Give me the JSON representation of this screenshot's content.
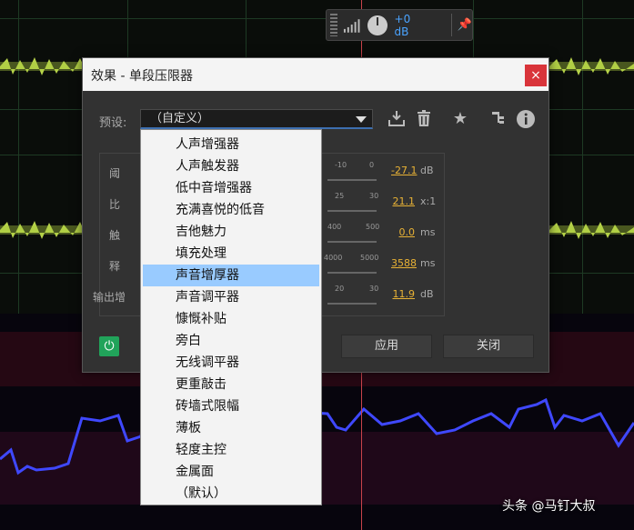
{
  "volume_hud": {
    "db_value": "+0 dB"
  },
  "dialog": {
    "title": "效果 - 单段压限器",
    "close_glyph": "×",
    "preset_label": "预设:",
    "preset_value": "（自定义）",
    "params": [
      {
        "label": "阈",
        "ticks": [
          "-10",
          "0"
        ],
        "value": "-27.1",
        "unit": "dB"
      },
      {
        "label": "比",
        "ticks": [
          "25",
          "30"
        ],
        "value": "21.1",
        "unit": "x:1"
      },
      {
        "label": "触",
        "ticks": [
          "400",
          "500"
        ],
        "value": "0.0",
        "unit": "ms"
      },
      {
        "label": "释",
        "ticks": [
          "4000",
          "5000"
        ],
        "value": "3588",
        "unit": "ms"
      },
      {
        "label": "输出增",
        "ticks": [
          "20",
          "30"
        ],
        "value": "11.9",
        "unit": "dB"
      }
    ],
    "apply_label": "应用",
    "close_label": "关闭"
  },
  "icons": {
    "save": "save-preset-icon",
    "delete": "trash-icon",
    "favorite": "star-icon",
    "routing": "routing-icon",
    "info": "info-icon",
    "power": "power-icon",
    "pin": "pin-icon"
  },
  "preset_menu": {
    "selected_index": 6,
    "items": [
      "人声增强器",
      "人声触发器",
      "低中音增强器",
      "充满喜悦的低音",
      "吉他魅力",
      "填充处理",
      "声音增厚器",
      "声音调平器",
      "慷慨补贴",
      "旁白",
      "无线调平器",
      "更重敲击",
      "砖墙式限幅",
      "薄板",
      "轻度主控",
      "金属面",
      "（默认）"
    ]
  },
  "watermark": "头条 @马钉大叔",
  "colors": {
    "accent": "#3d6fb0",
    "value": "#e8b235",
    "power": "#21a35a",
    "close": "#d9343a",
    "menu_selected": "#99cbff"
  }
}
